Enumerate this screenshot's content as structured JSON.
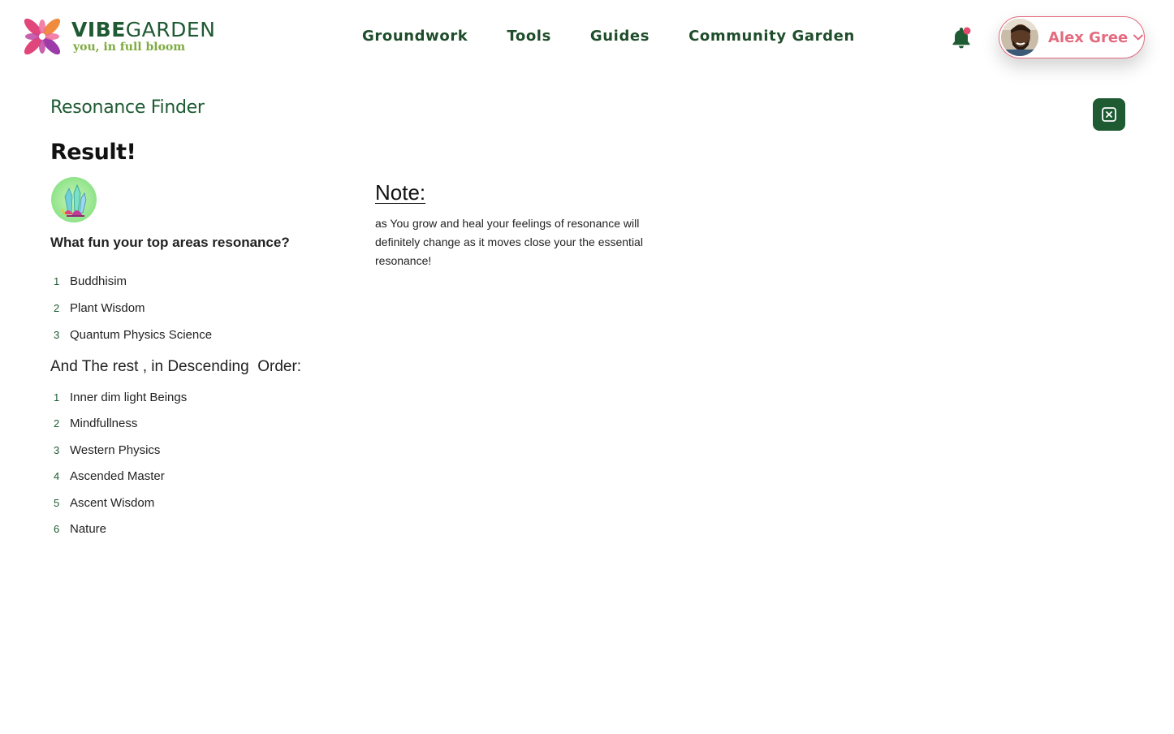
{
  "brand": {
    "name_bold": "VIBE",
    "name_light": "GARDEN",
    "tagline": "you, in full bloom",
    "colors": {
      "primary": "#1e5a32",
      "accent": "#e46b7f",
      "leaf": "#7dab3f"
    }
  },
  "nav": {
    "items": [
      {
        "label": "Groundwork"
      },
      {
        "label": "Tools"
      },
      {
        "label": "Guides"
      },
      {
        "label": "Community Garden"
      }
    ]
  },
  "header": {
    "notification_icon": "bell-icon",
    "has_unread": true,
    "user": {
      "name": "Alex Gree",
      "menu_icon": "chevron-down-icon"
    }
  },
  "main": {
    "section_title": "Resonance Finder",
    "close_icon": "close-square-icon",
    "result_title": "Result!",
    "result_icon": "crystal-icon",
    "top_question": "What fun your top areas resonance?",
    "top_areas": [
      {
        "rank": "1",
        "label": "Buddhisim"
      },
      {
        "rank": "2",
        "label": "Plant Wisdom"
      },
      {
        "rank": "3",
        "label": "Quantum Physics Science"
      }
    ],
    "rest_heading": "And The rest , in Descending  Order:",
    "rest_areas": [
      {
        "rank": "1",
        "label": "Inner dim light Beings"
      },
      {
        "rank": "2",
        "label": "Mindfullness"
      },
      {
        "rank": "3",
        "label": "Western Physics"
      },
      {
        "rank": "4",
        "label": "Ascended Master"
      },
      {
        "rank": "5",
        "label": "Ascent Wisdom"
      },
      {
        "rank": "6",
        "label": "Nature"
      }
    ],
    "note": {
      "title": "Note:",
      "body": "as You grow and heal your feelings of resonance will definitely change as it moves close your the essential resonance!"
    }
  }
}
